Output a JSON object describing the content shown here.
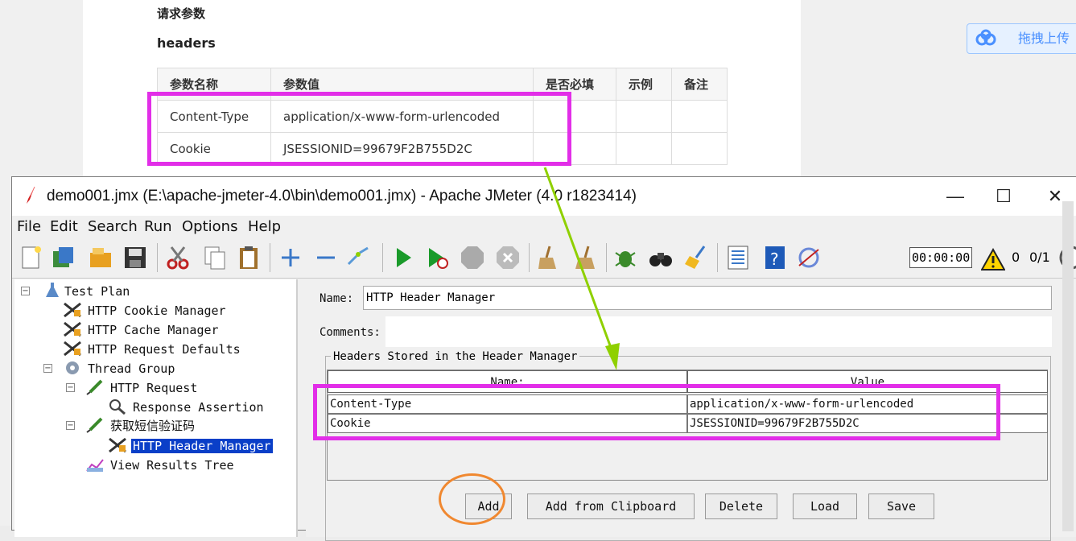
{
  "doc": {
    "heading_params": "请求参数",
    "heading_headers": "headers",
    "columns": [
      "参数名称",
      "参数值",
      "是否必填",
      "示例",
      "备注"
    ],
    "rows": [
      [
        "Content-Type",
        "application/x-www-form-urlencoded",
        "",
        "",
        ""
      ],
      [
        "Cookie",
        "JSESSIONID=99679F2B755D2C",
        "",
        "",
        ""
      ]
    ]
  },
  "upload": {
    "label": "拖拽上传"
  },
  "window": {
    "title": "demo001.jmx (E:\\apache-jmeter-4.0\\bin\\demo001.jmx) - Apache JMeter (4.0 r1823414)",
    "minimize": "—",
    "maximize": "☐",
    "close": "✕"
  },
  "menu": {
    "items": [
      "File",
      "Edit",
      "Search",
      "Run",
      "Options",
      "Help"
    ]
  },
  "toolbar": {
    "timer": "00:00:00",
    "warnings": "0",
    "threads": "0/1"
  },
  "tree": {
    "items": [
      {
        "label": "Test Plan"
      },
      {
        "label": "HTTP Cookie Manager"
      },
      {
        "label": "HTTP Cache Manager"
      },
      {
        "label": "HTTP Request Defaults"
      },
      {
        "label": "Thread Group"
      },
      {
        "label": "HTTP Request"
      },
      {
        "label": "Response Assertion"
      },
      {
        "label": "获取短信验证码"
      },
      {
        "label": "HTTP Header Manager"
      },
      {
        "label": "View Results Tree"
      }
    ]
  },
  "panel": {
    "name_label": "Name:",
    "name_value": "HTTP Header Manager",
    "comments_label": "Comments:",
    "comments_value": "",
    "group_title": "Headers Stored in the Header Manager",
    "col_name": "Name:",
    "col_value": "Value",
    "rows": [
      {
        "name": "Content-Type",
        "value": "application/x-www-form-urlencoded"
      },
      {
        "name": "Cookie",
        "value": "JSESSIONID=99679F2B755D2C"
      }
    ],
    "buttons": {
      "add": "Add",
      "add_clipboard": "Add from Clipboard",
      "delete": "Delete",
      "load": "Load",
      "save": "Save"
    }
  },
  "colors": {
    "highlight": "#e22ee8",
    "circle": "#f08830",
    "arrow": "#8fd000",
    "selection": "#0a3fc8"
  }
}
